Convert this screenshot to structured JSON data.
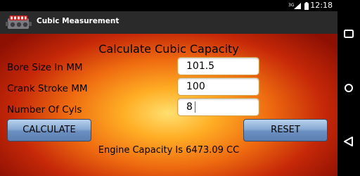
{
  "status_bar": {
    "network_label": "3G",
    "time": "12:18"
  },
  "action_bar": {
    "title": "Cubic Measurement",
    "icon": "engine-icon"
  },
  "form": {
    "heading": "Calculate Cubic Capacity",
    "bore": {
      "label": "Bore Size In MM",
      "value": "101.5"
    },
    "stroke": {
      "label": "Crank Stroke MM",
      "value": "100"
    },
    "cylinders": {
      "label": "Number Of Cyls",
      "value": "8"
    }
  },
  "buttons": {
    "calculate": "CALCULATE",
    "reset": "RESET"
  },
  "result": "Engine Capacity Is 6473.09 CC",
  "nav_bar": {
    "icons": [
      "recent-apps-icon",
      "home-icon",
      "back-icon"
    ]
  },
  "colors": {
    "action_bar": "#2a2a2a",
    "button_top": "#b9d2ee",
    "button_bottom": "#5a7fb0",
    "background_center": "#ffe070",
    "background_edge": "#8e1003"
  }
}
